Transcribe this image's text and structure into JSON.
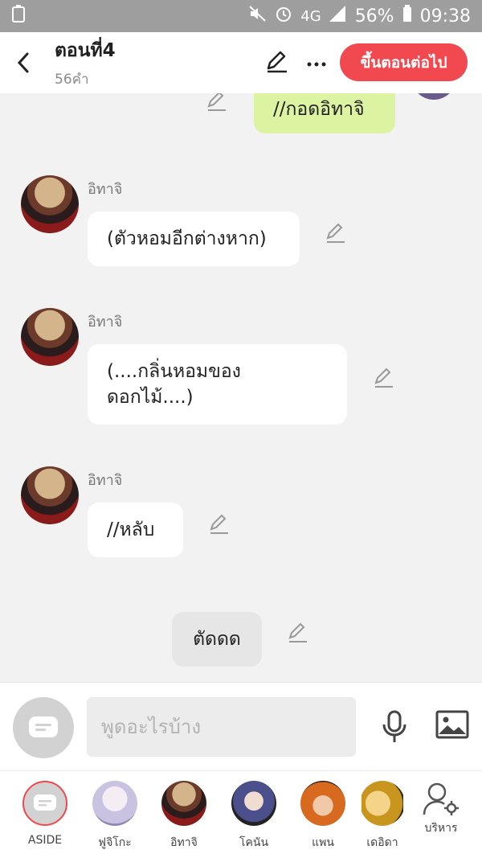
{
  "status_bar": {
    "battery": "56%",
    "time": "09:38",
    "network": "4G"
  },
  "header": {
    "title": "ตอนที่4",
    "subtitle": "56คำ",
    "next_label": "ขึ้นตอนต่อไป"
  },
  "messages": [
    {
      "side": "right",
      "text": "//กอดอิทาจิ"
    },
    {
      "side": "left",
      "name": "อิทาจิ",
      "text": "(ตัวหอมอีกต่างหาก)"
    },
    {
      "side": "left",
      "name": "อิทาจิ",
      "text": "(....กลิ่นหอมของ\nดอกไม้....)"
    },
    {
      "side": "left",
      "name": "อิทาจิ",
      "text": "//หลับ"
    },
    {
      "side": "center",
      "text": "ตัดดด"
    }
  ],
  "input": {
    "placeholder": "พูดอะไรบ้าง"
  },
  "characters": [
    {
      "label": "ASIDE"
    },
    {
      "label": "ฟูจิโกะ"
    },
    {
      "label": "อิทาจิ"
    },
    {
      "label": "โคนัน"
    },
    {
      "label": "แพน"
    },
    {
      "label": "เดอิดา"
    },
    {
      "label": "บริหาร"
    }
  ],
  "colors": {
    "accent": "#f2484f",
    "bubble_self": "#dcf4a1",
    "bubble_other": "#ffffff"
  }
}
